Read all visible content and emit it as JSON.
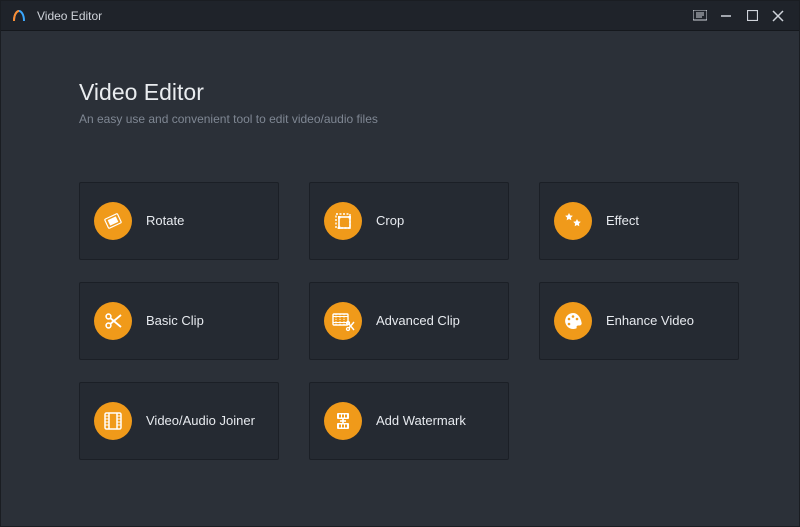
{
  "colors": {
    "accent": "#f09a1a",
    "panel": "#2b3038",
    "tile": "#252a32"
  },
  "titlebar": {
    "app_name": "Video Editor",
    "logo_icon": "app-logo-icon",
    "buttons": {
      "menu_icon": "menu-icon",
      "minimize_icon": "minimize-icon",
      "maximize_icon": "maximize-icon",
      "close_icon": "close-icon"
    }
  },
  "header": {
    "title": "Video Editor",
    "subtitle": "An easy use and convenient tool to edit video/audio files"
  },
  "tools": [
    {
      "id": "rotate",
      "label": "Rotate",
      "icon": "rotate-icon"
    },
    {
      "id": "crop",
      "label": "Crop",
      "icon": "crop-icon"
    },
    {
      "id": "effect",
      "label": "Effect",
      "icon": "effect-icon"
    },
    {
      "id": "basic-clip",
      "label": "Basic Clip",
      "icon": "scissors-icon"
    },
    {
      "id": "advanced-clip",
      "label": "Advanced Clip",
      "icon": "advanced-clip-icon"
    },
    {
      "id": "enhance-video",
      "label": "Enhance Video",
      "icon": "palette-icon"
    },
    {
      "id": "joiner",
      "label": "Video/Audio Joiner",
      "icon": "joiner-icon"
    },
    {
      "id": "watermark",
      "label": "Add Watermark",
      "icon": "watermark-icon"
    }
  ]
}
